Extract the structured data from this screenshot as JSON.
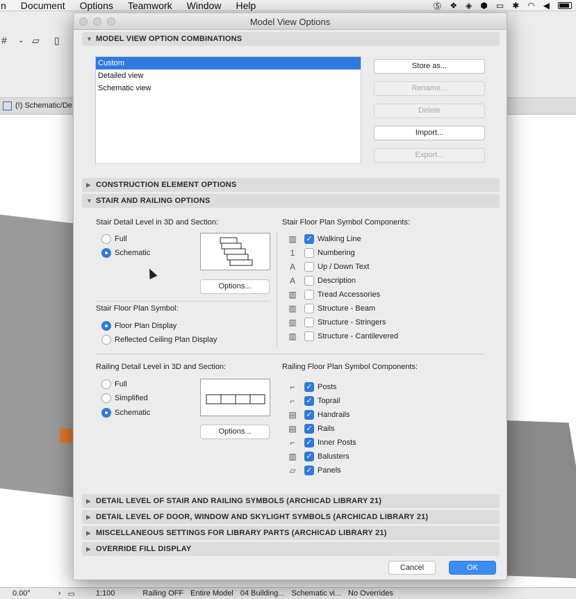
{
  "menubar": {
    "items": [
      "n",
      "Document",
      "Options",
      "Teamwork",
      "Window",
      "Help"
    ]
  },
  "background": {
    "view_tab": "(!) Schematic/De",
    "status": [
      "0.00°",
      "1:100",
      "Railing OFF",
      "Entire Model",
      "04 Building...",
      "Schematic vi...",
      "No Overrides"
    ]
  },
  "dialog": {
    "title": "Model View Options",
    "sections": {
      "combinations": "MODEL VIEW OPTION COMBINATIONS",
      "construction": "CONSTRUCTION ELEMENT OPTIONS",
      "stair_railing": "STAIR AND RAILING OPTIONS",
      "detail_symbols": "DETAIL LEVEL OF STAIR AND RAILING SYMBOLS (ARCHICAD LIBRARY 21)",
      "door_window": "DETAIL LEVEL OF DOOR, WINDOW AND SKYLIGHT SYMBOLS (ARCHICAD LIBRARY 21)",
      "misc": "MISCELLANEOUS SETTINGS FOR LIBRARY PARTS (ARCHICAD LIBRARY 21)",
      "override": "OVERRIDE FILL DISPLAY"
    },
    "combinations_list": [
      "Custom",
      "Detailed view",
      "Schematic view"
    ],
    "combo_buttons": {
      "store": "Store as...",
      "rename": "Rename...",
      "delete": "Delete",
      "import": "Import...",
      "export": "Export..."
    },
    "stair_detail": {
      "label": "Stair Detail Level in 3D and Section:",
      "options": [
        "Full",
        "Schematic"
      ],
      "selected": "Schematic",
      "options_button": "Options..."
    },
    "stair_floor_symbol": {
      "label": "Stair Floor Plan Symbol:",
      "options": [
        "Floor Plan Display",
        "Reflected Ceiling Plan Display"
      ],
      "selected": "Floor Plan Display"
    },
    "stair_components": {
      "label": "Stair Floor Plan Symbol Components:",
      "items": [
        {
          "label": "Walking Line",
          "checked": true,
          "icon": "walking-line-icon",
          "glyph": "▥"
        },
        {
          "label": "Numbering",
          "checked": false,
          "icon": "numbering-icon",
          "glyph": "1"
        },
        {
          "label": "Up / Down Text",
          "checked": false,
          "icon": "text-a-icon",
          "glyph": "A"
        },
        {
          "label": "Description",
          "checked": false,
          "icon": "text-a-icon",
          "glyph": "A"
        },
        {
          "label": "Tread Accessories",
          "checked": false,
          "icon": "tread-icon",
          "glyph": "▥"
        },
        {
          "label": "Structure - Beam",
          "checked": false,
          "icon": "structure-icon",
          "glyph": "▥"
        },
        {
          "label": "Structure - Stringers",
          "checked": false,
          "icon": "structure-icon",
          "glyph": "▥"
        },
        {
          "label": "Structure - Cantilevered",
          "checked": false,
          "icon": "structure-icon",
          "glyph": "▥"
        }
      ]
    },
    "railing_detail": {
      "label": "Railing Detail Level in 3D and Section:",
      "options": [
        "Full",
        "Simplified",
        "Schematic"
      ],
      "selected": "Schematic",
      "options_button": "Options..."
    },
    "railing_components": {
      "label": "Railing Floor Plan Symbol Components:",
      "items": [
        {
          "label": "Posts",
          "checked": true,
          "icon": "posts-icon",
          "glyph": "⌐"
        },
        {
          "label": "Toprail",
          "checked": true,
          "icon": "toprail-icon",
          "glyph": "⌐"
        },
        {
          "label": "Handrails",
          "checked": true,
          "icon": "handrails-icon",
          "glyph": "▤"
        },
        {
          "label": "Rails",
          "checked": true,
          "icon": "rails-icon",
          "glyph": "▤"
        },
        {
          "label": "Inner Posts",
          "checked": true,
          "icon": "inner-posts-icon",
          "glyph": "⌐"
        },
        {
          "label": "Balusters",
          "checked": true,
          "icon": "balusters-icon",
          "glyph": "▥"
        },
        {
          "label": "Panels",
          "checked": true,
          "icon": "panels-icon",
          "glyph": "▱"
        }
      ]
    },
    "footer": {
      "cancel": "Cancel",
      "ok": "OK"
    }
  },
  "colors": {
    "accent": "#2f7ae0",
    "ok_button": "#3a8df2",
    "section_header": "#dcdcdc"
  }
}
